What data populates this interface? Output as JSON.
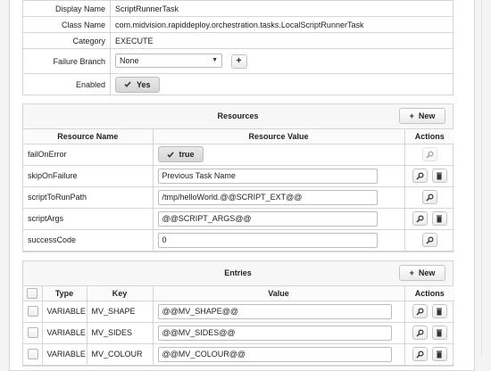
{
  "task": {
    "display_name_label": "Display Name",
    "display_name": "ScriptRunnerTask",
    "class_name_label": "Class Name",
    "class_name": "com.midvision.rapiddeploy.orchestration.tasks.LocalScriptRunnerTask",
    "category_label": "Category",
    "category": "EXECUTE",
    "failure_branch_label": "Failure Branch",
    "failure_branch_value": "None",
    "add_label": "+",
    "enabled_label": "Enabled",
    "enabled_value": "Yes"
  },
  "resources": {
    "title": "Resources",
    "new_label": "New",
    "columns": {
      "name": "Resource Name",
      "value": "Resource Value",
      "actions": "Actions"
    },
    "rows": [
      {
        "name": "failOnError",
        "toggle": "true"
      },
      {
        "name": "skipOnFailure",
        "value": "Previous Task Name"
      },
      {
        "name": "scriptToRunPath",
        "value": "/tmp/helloWorld.@@SCRIPT_EXT@@"
      },
      {
        "name": "scriptArgs",
        "value": "@@SCRIPT_ARGS@@"
      },
      {
        "name": "successCode",
        "value": "0"
      }
    ]
  },
  "entries": {
    "title": "Entries",
    "new_label": "New",
    "columns": {
      "type": "Type",
      "key": "Key",
      "value": "Value",
      "actions": "Actions"
    },
    "rows": [
      {
        "type": "VARIABLE",
        "key": "MV_SHAPE",
        "value": "@@MV_SHAPE@@"
      },
      {
        "type": "VARIABLE",
        "key": "MV_SIDES",
        "value": "@@MV_SIDES@@"
      },
      {
        "type": "VARIABLE",
        "key": "MV_COLOUR",
        "value": "@@MV_COLOUR@@"
      }
    ]
  },
  "icons": {
    "plus": "plus-icon",
    "check": "check-icon",
    "search": "search-icon",
    "delete": "trash-icon",
    "caret": "caret-down-icon"
  }
}
